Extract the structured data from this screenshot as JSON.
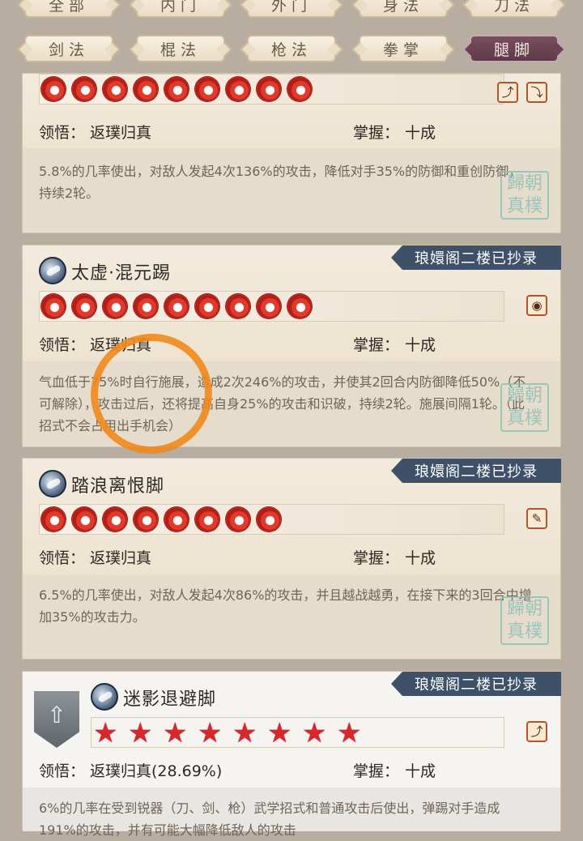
{
  "tabs_row1": [
    "全部",
    "内门",
    "外门",
    "身法",
    "刀法"
  ],
  "tabs_row2": [
    "剑法",
    "棍法",
    "枪法",
    "拳掌",
    "腿脚"
  ],
  "active_tab": "腿脚",
  "cards": [
    {
      "comprehension_label": "领悟：",
      "comprehension_value": "返璞归真",
      "mastery_label": "掌握：",
      "mastery_value": "十成",
      "description": "5.8%的几率使出，对敌人发起4次136%的攻击，降低对手35%的防御和重创防御，持续2轮。",
      "seal_text": "歸朝真樸"
    },
    {
      "banner": "琅嬛阁二楼已抄录",
      "name": "太虚·混元踢",
      "comprehension_label": "领悟：",
      "comprehension_value": "返璞归真",
      "mastery_label": "掌握：",
      "mastery_value": "十成",
      "description": "气血低于75%时自行施展，造成2次246%的攻击，并使其2回合内防御降低50%（不可解除），攻击过后，还将提高自身25%的攻击和识破，持续2轮。施展间隔1轮。（此招式不会占用出手机会）",
      "seal_text": "歸朝真樸"
    },
    {
      "banner": "琅嬛阁二楼已抄录",
      "name": "踏浪离恨脚",
      "comprehension_label": "领悟：",
      "comprehension_value": "返璞归真",
      "mastery_label": "掌握：",
      "mastery_value": "十成",
      "description": "6.5%的几率使出，对敌人发起4次86%的攻击，并且越战越勇，在接下来的3回合中增加35%的攻击力。",
      "seal_text": "歸朝真樸"
    },
    {
      "banner": "琅嬛阁二楼已抄录",
      "name": "迷影退避脚",
      "comprehension_label": "领悟：",
      "comprehension_value": "返璞归真(28.69%)",
      "mastery_label": "掌握：",
      "mastery_value": "十成",
      "description": "6%的几率在受到锐器（刀、剑、枪）武学招式和普通攻击后使出，弹踢对手造成191%的攻击，并有可能大幅降低敌人的攻击"
    }
  ]
}
